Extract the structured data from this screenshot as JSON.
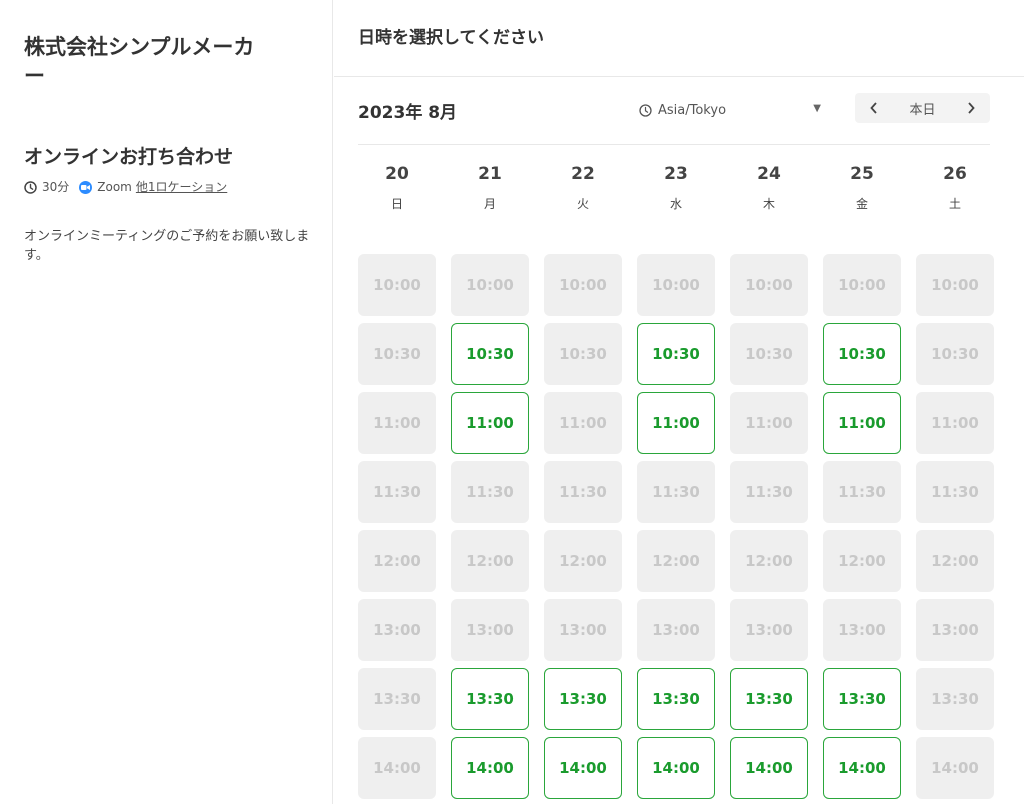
{
  "left": {
    "company": "株式会社シンプルメーカー",
    "event_title": "オンラインお打ち合わせ",
    "duration": "30分",
    "platform": "Zoom",
    "location_link": "他1ロケーション",
    "description": "オンラインミーティングのご予約をお願い致します。"
  },
  "right": {
    "heading": "日時を選択してください",
    "month_label": "2023年 8月",
    "timezone": "Asia/Tokyo",
    "nav": {
      "prev": "‹",
      "today": "本日",
      "next": "›"
    }
  },
  "days": [
    {
      "num": "20",
      "weekday": "日"
    },
    {
      "num": "21",
      "weekday": "月"
    },
    {
      "num": "22",
      "weekday": "火"
    },
    {
      "num": "23",
      "weekday": "水"
    },
    {
      "num": "24",
      "weekday": "木"
    },
    {
      "num": "25",
      "weekday": "金"
    },
    {
      "num": "26",
      "weekday": "土"
    }
  ],
  "times": [
    "10:00",
    "10:30",
    "11:00",
    "11:30",
    "12:00",
    "12:00",
    "13:00",
    "13:30",
    "14:00"
  ],
  "slot_rows": [
    {
      "time": "10:00",
      "available": [
        false,
        false,
        false,
        false,
        false,
        false,
        false
      ]
    },
    {
      "time": "10:30",
      "available": [
        false,
        true,
        false,
        true,
        false,
        true,
        false
      ]
    },
    {
      "time": "11:00",
      "available": [
        false,
        true,
        false,
        true,
        false,
        true,
        false
      ]
    },
    {
      "time": "11:30",
      "available": [
        false,
        false,
        false,
        false,
        false,
        false,
        false
      ]
    },
    {
      "time": "12:00",
      "available": [
        false,
        false,
        false,
        false,
        false,
        false,
        false
      ]
    },
    {
      "time": "13:00",
      "available": [
        false,
        false,
        false,
        false,
        false,
        false,
        false
      ]
    },
    {
      "time": "13:30",
      "available": [
        false,
        true,
        true,
        true,
        true,
        true,
        false
      ]
    },
    {
      "time": "14:00",
      "available": [
        false,
        true,
        true,
        true,
        true,
        true,
        false
      ]
    }
  ],
  "colors": {
    "available_text": "#1a9b2d",
    "available_border": "#2aa63b",
    "unavailable_bg": "#efefef",
    "unavailable_text": "#c8c8c8",
    "zoom_blue": "#2d8cff"
  },
  "icons": {
    "clock": "clock-icon",
    "zoom": "zoom-video-icon",
    "caret": "caret-down-icon"
  }
}
